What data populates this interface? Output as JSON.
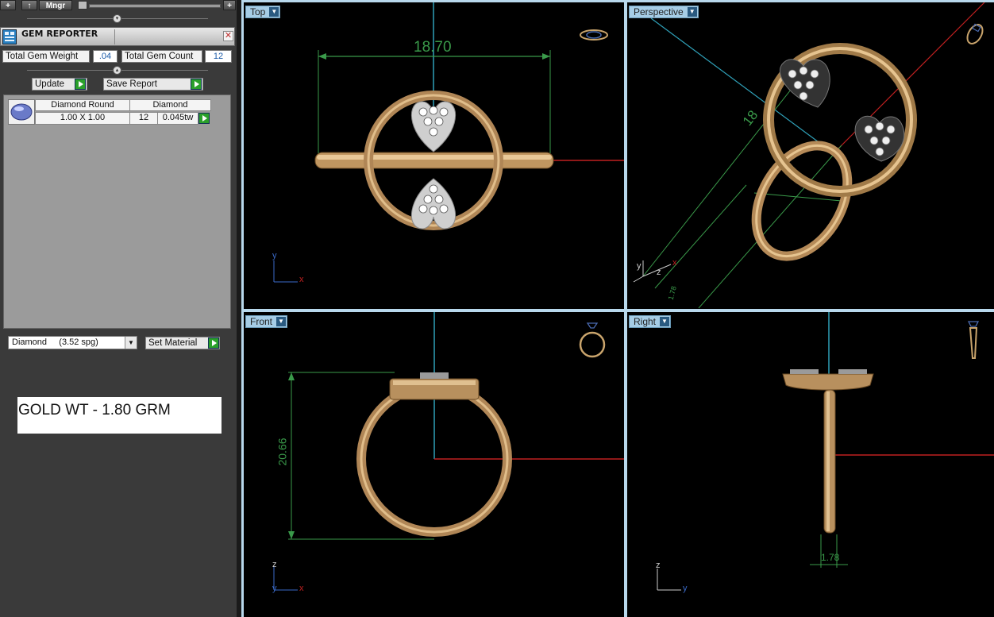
{
  "toolbar": {
    "add_label": "+",
    "up_label": "↑",
    "manager_label": "Mngr",
    "plus_label": "+"
  },
  "gem_reporter": {
    "title": "GEM REPORTER",
    "close_label": "✕",
    "total_weight_label": "Total Gem Weight",
    "total_weight_value": ".04",
    "total_count_label": "Total Gem Count",
    "total_count_value": "12",
    "update_label": "Update",
    "save_label": "Save Report",
    "table": {
      "headers": [
        "Diamond Round",
        "Diamond"
      ],
      "row": {
        "size": "1.00 X 1.00",
        "count": "12",
        "weight": "0.045tw"
      }
    }
  },
  "material": {
    "selected": "Diamond     (3.52 spg)",
    "set_label": "Set Material"
  },
  "note": "GOLD WT - 1.80 GRM",
  "viewports": {
    "top": {
      "label": "Top",
      "dimension": "18.70",
      "axis_y": "y",
      "axis_x": "x"
    },
    "perspective": {
      "label": "Perspective",
      "dimension": "18",
      "dimension_small": "1.78",
      "axis_x": "x",
      "axis_y": "y",
      "axis_z": "z"
    },
    "front": {
      "label": "Front",
      "dimension": "20.66",
      "axis_z": "z",
      "axis_y": "y",
      "axis_x": "x"
    },
    "right": {
      "label": "Right",
      "dimension": "1.78",
      "axis_z": "z",
      "axis_y": "y"
    }
  },
  "colors": {
    "gold": "#c9a46c",
    "gold_dark": "#8a6a3c",
    "dimension_green": "#3a9a4a",
    "axis_red": "#c02020",
    "axis_cyan": "#2fa0b8"
  }
}
